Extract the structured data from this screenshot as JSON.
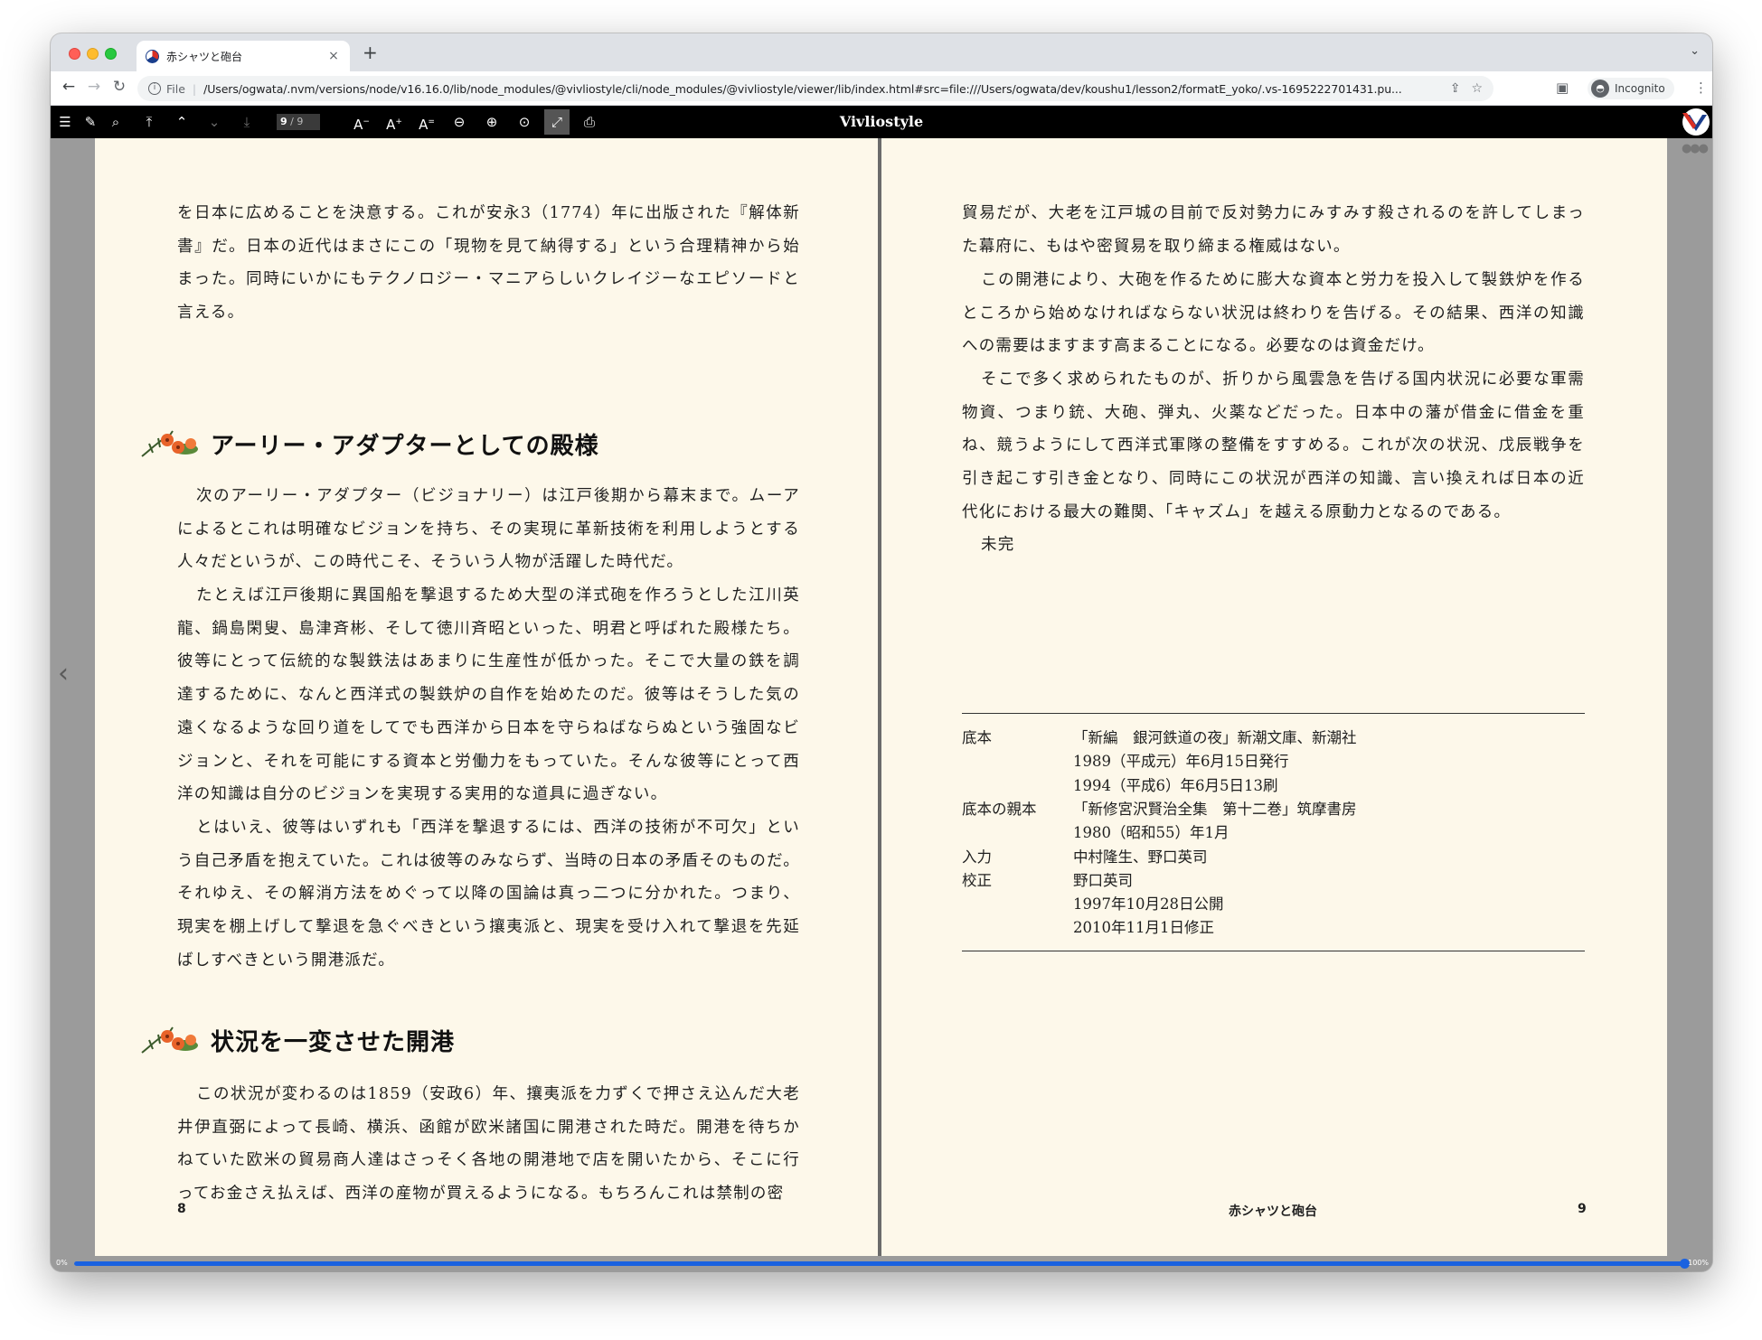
{
  "browser": {
    "tab_title": "赤シャツと砲台",
    "tab_close": "×",
    "new_tab": "+",
    "tab_menu": "⌄",
    "scheme": "File",
    "url": "/Users/ogwata/.nvm/versions/node/v16.16.0/lib/node_modules/@vivliostyle/cli/node_modules/@vivliostyle/viewer/lib/index.html#src=file:///Users/ogwata/dev/koushu1/lesson2/formatE_yoko/.vs-1695222701431.pu...",
    "profile": "Incognito"
  },
  "viewer": {
    "title": "Vivliostyle",
    "page_current": "9",
    "page_total": "/ 9",
    "progress_percent": 100,
    "progress_start_label": "0%",
    "progress_end_label": "100%"
  },
  "left_page": {
    "para1": "を日本に広めることを決意する。これが安永3（1774）年に出版された『解体新書』だ。日本の近代はまさにこの「現物を見て納得する」という合理精神から始まった。同時にいかにもテクノロジー・マニアらしいクレイジーなエピソードと言える。",
    "heading1": "アーリー・アダプターとしての殿様",
    "para2": "次のアーリー・アダプター（ビジョナリー）は江戸後期から幕末まで。ムーアによるとこれは明確なビジョンを持ち、その実現に革新技術を利用しようとする人々だというが、この時代こそ、そういう人物が活躍した時代だ。",
    "para3": "たとえば江戸後期に異国船を撃退するため大型の洋式砲を作ろうとした江川英龍、鍋島閑叟、島津斉彬、そして徳川斉昭といった、明君と呼ばれた殿様たち。彼等にとって伝統的な製鉄法はあまりに生産性が低かった。そこで大量の鉄を調達するために、なんと西洋式の製鉄炉の自作を始めたのだ。彼等はそうした気の遠くなるような回り道をしてでも西洋から日本を守らねばならぬという強固なビジョンと、それを可能にする資本と労働力をもっていた。そんな彼等にとって西洋の知識は自分のビジョンを実現する実用的な道具に過ぎない。",
    "para4": "とはいえ、彼等はいずれも「西洋を撃退するには、西洋の技術が不可欠」という自己矛盾を抱えていた。これは彼等のみならず、当時の日本の矛盾そのものだ。それゆえ、その解消方法をめぐって以降の国論は真っ二つに分かれた。つまり、現実を棚上げして撃退を急ぐべきという攘夷派と、現実を受け入れて撃退を先延ばしすべきという開港派だ。",
    "heading2": "状況を一変させた開港",
    "para5": "この状況が変わるのは1859（安政6）年、攘夷派を力ずくで押さえ込んだ大老井伊直弼によって長崎、横浜、函館が欧米諸国に開港された時だ。開港を待ちかねていた欧米の貿易商人達はさっそく各地の開港地で店を開いたから、そこに行ってお金さえ払えば、西洋の産物が買えるようになる。もちろんこれは禁制の密",
    "folio": "8"
  },
  "right_page": {
    "para1": "貿易だが、大老を江戸城の目前で反対勢力にみすみす殺されるのを許してしまった幕府に、もはや密貿易を取り締まる権威はない。",
    "para2": "この開港により、大砲を作るために膨大な資本と労力を投入して製鉄炉を作るところから始めなければならない状況は終わりを告げる。その結果、西洋の知識への需要はますます高まることになる。必要なのは資金だけ。",
    "para3": "そこで多く求められたものが、折りから風雲急を告げる国内状況に必要な軍需物資、つまり銃、大砲、弾丸、火薬などだった。日本中の藩が借金に借金を重ね、競うようにして西洋式軍隊の整備をすすめる。これが次の状況、戊辰戦争を引き起こす引き金となり、同時にこの状況が西洋の知識、言い換えれば日本の近代化における最大の難関、「キャズム」を越える原動力となるのである。",
    "para4": "未完",
    "colophon": [
      {
        "label": "底本",
        "value": "「新編　銀河鉄道の夜」新潮文庫、新潮社"
      },
      {
        "label": "",
        "value": "1989（平成元）年6月15日発行"
      },
      {
        "label": "",
        "value": "1994（平成6）年6月5日13刷"
      },
      {
        "label": "底本の親本",
        "value": "「新修宮沢賢治全集　第十二巻」筑摩書房"
      },
      {
        "label": "",
        "value": "1980（昭和55）年1月"
      },
      {
        "label": "入力",
        "value": "中村隆生、野口英司"
      },
      {
        "label": "校正",
        "value": "野口英司"
      },
      {
        "label": "",
        "value": "1997年10月28日公開"
      },
      {
        "label": "",
        "value": "2010年11月1日修正"
      }
    ],
    "running_head": "赤シャツと砲台",
    "folio": "9"
  },
  "colors": {
    "page_bg": "#fdf8ea",
    "viewer_bg": "#9b9b9b",
    "toolbar_bg": "#000000",
    "progress_blue": "#1a62e0"
  }
}
